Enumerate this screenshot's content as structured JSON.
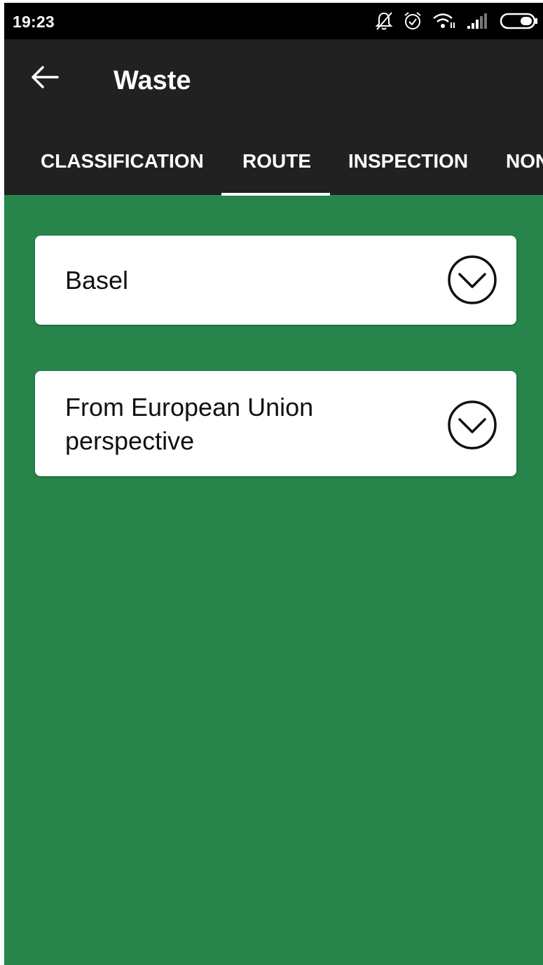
{
  "status_bar": {
    "time": "19:23",
    "icons": [
      "bell-off-icon",
      "alarm-icon",
      "wifi-icon",
      "signal-icon",
      "battery-icon"
    ]
  },
  "app_bar": {
    "title": "Waste",
    "back_icon": "arrow-left-icon",
    "tabs": [
      {
        "label": "CLASSIFICATION"
      },
      {
        "label": "ROUTE",
        "selected": true
      },
      {
        "label": "INSPECTION"
      },
      {
        "label": "NON"
      }
    ]
  },
  "content": {
    "cards": [
      {
        "label": "Basel",
        "icon": "chevron-down-circle-icon"
      },
      {
        "label_line1": "From European Union",
        "label_line2": "perspective",
        "icon": "chevron-down-circle-icon"
      }
    ]
  },
  "colors": {
    "app_bar": "#212121",
    "status_bar": "#000000",
    "background_green": "#27844b",
    "card": "#ffffff"
  }
}
